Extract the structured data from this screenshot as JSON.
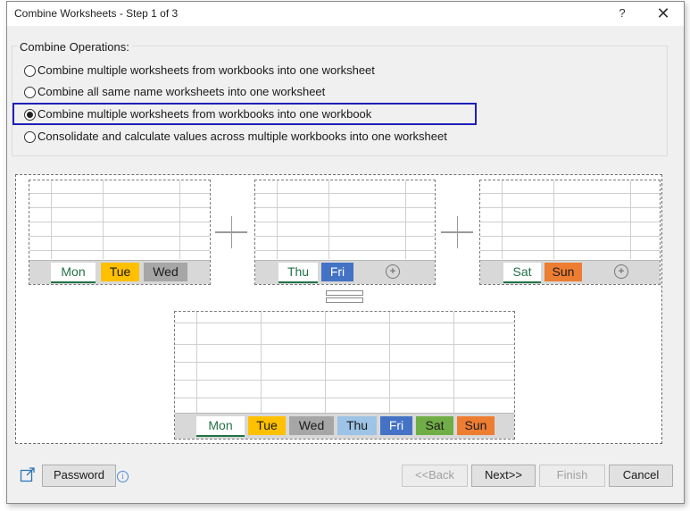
{
  "window": {
    "title": "Combine Worksheets - Step 1 of 3",
    "help_glyph": "?",
    "close_glyph": "✕"
  },
  "operations": {
    "group_label": "Combine Operations:",
    "options": [
      {
        "label": "Combine multiple worksheets from workbooks into one worksheet",
        "selected": false
      },
      {
        "label": "Combine all same name worksheets into one worksheet",
        "selected": false
      },
      {
        "label": "Combine multiple worksheets from workbooks into one workbook",
        "selected": true
      },
      {
        "label": "Consolidate and calculate values across multiple workbooks into one worksheet",
        "selected": false
      }
    ]
  },
  "preview": {
    "colors": {
      "mon": "#ffffff",
      "tue": "#ffc000",
      "wed": "#a6a6a6",
      "thu": "#9dc3e6",
      "fri": "#4472c4",
      "sat": "#70ad47",
      "sun": "#ed7d31",
      "active_text": "#217346"
    },
    "book1_tabs": [
      "Mon",
      "Tue",
      "Wed"
    ],
    "book2_tabs": [
      "Thu",
      "Fri"
    ],
    "book3_tabs": [
      "Sat",
      "Sun"
    ],
    "result_tabs": [
      "Mon",
      "Tue",
      "Wed",
      "Thu",
      "Fri",
      "Sat",
      "Sun"
    ],
    "add_sheet_glyph": "+"
  },
  "footer": {
    "password_label": "Password",
    "info_glyph": "i",
    "back_label": "<<Back",
    "next_label": "Next>>",
    "finish_label": "Finish",
    "cancel_label": "Cancel"
  }
}
